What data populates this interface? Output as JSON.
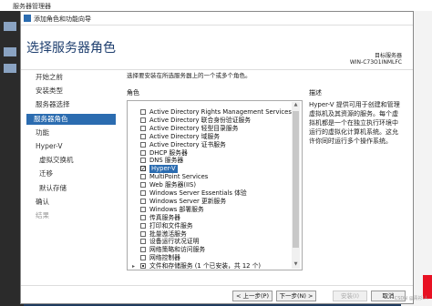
{
  "app_title": "服务器管理器",
  "dialog": {
    "title": "添加角色和功能向导",
    "heading": "选择服务器角色",
    "target_label": "目标服务器",
    "target_server": "WIN-C73O1INMLFC"
  },
  "nav": [
    {
      "label": "开始之前",
      "state": "normal"
    },
    {
      "label": "安装类型",
      "state": "normal"
    },
    {
      "label": "服务器选择",
      "state": "normal"
    },
    {
      "label": "服务器角色",
      "state": "selected"
    },
    {
      "label": "功能",
      "state": "normal"
    },
    {
      "label": "Hyper-V",
      "state": "normal"
    },
    {
      "label": "虚拟交换机",
      "state": "sub"
    },
    {
      "label": "迁移",
      "state": "sub"
    },
    {
      "label": "默认存储",
      "state": "sub"
    },
    {
      "label": "确认",
      "state": "normal"
    },
    {
      "label": "结果",
      "state": "dim"
    }
  ],
  "intro": "选择要安装在所选服务器上的一个或多个角色。",
  "roles_header": "角色",
  "roles": [
    {
      "label": "Active Directory Rights Management Services",
      "checked": false
    },
    {
      "label": "Active Directory 联合身份验证服务",
      "checked": false
    },
    {
      "label": "Active Directory 轻型目录服务",
      "checked": false
    },
    {
      "label": "Active Directory 域服务",
      "checked": false
    },
    {
      "label": "Active Directory 证书服务",
      "checked": false
    },
    {
      "label": "DHCP 服务器",
      "checked": false
    },
    {
      "label": "DNS 服务器",
      "checked": false
    },
    {
      "label": "Hyper-V",
      "checked": true,
      "highlight": true
    },
    {
      "label": "MultiPoint Services",
      "checked": false
    },
    {
      "label": "Web 服务器(IIS)",
      "checked": false
    },
    {
      "label": "Windows Server Essentials 体验",
      "checked": false
    },
    {
      "label": "Windows Server 更新服务",
      "checked": false
    },
    {
      "label": "Windows 部署服务",
      "checked": false
    },
    {
      "label": "传真服务器",
      "checked": false
    },
    {
      "label": "打印和文件服务",
      "checked": false
    },
    {
      "label": "批量激活服务",
      "checked": false
    },
    {
      "label": "设备运行状况证明",
      "checked": false
    },
    {
      "label": "网络策略和访问服务",
      "checked": false
    },
    {
      "label": "网络控制器",
      "checked": false
    },
    {
      "label": "文件和存储服务 (1 个已安装，共 12 个)",
      "checked": "partial",
      "expander": "▸"
    }
  ],
  "description_header": "描述",
  "description": "Hyper-V 提供可用于创建和管理虚拟机及其资源的服务。每个虚拟机都是一个在独立执行环境中运行的虚拟化计算机系统。这允许你同时运行多个操作系统。",
  "buttons": {
    "prev": "< 上一步(P)",
    "next": "下一步(N) >",
    "install": "安装(I)",
    "cancel": "取消"
  },
  "watermark": "CSDN @青衫i人"
}
